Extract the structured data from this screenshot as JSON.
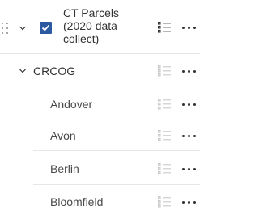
{
  "layer": {
    "title_lines": [
      "CT Parcels",
      "(2020 data",
      "collect)"
    ],
    "checked": true,
    "drag_icon": "drag-handle-icon",
    "legend_icon": "legend-list-icon",
    "options_icon": "more-options-icon",
    "expand_icon": "chevron-down-icon"
  },
  "group": {
    "label": "CRCOG",
    "expand_icon": "chevron-down-icon",
    "items": [
      {
        "label": "Andover"
      },
      {
        "label": "Avon"
      },
      {
        "label": "Berlin"
      },
      {
        "label": "Bloomfield"
      }
    ]
  },
  "colors": {
    "checkbox": "#2c5aa0",
    "divider": "#e6e6e6",
    "text": "#323232",
    "disabled_icon": "#c8c8c8"
  }
}
